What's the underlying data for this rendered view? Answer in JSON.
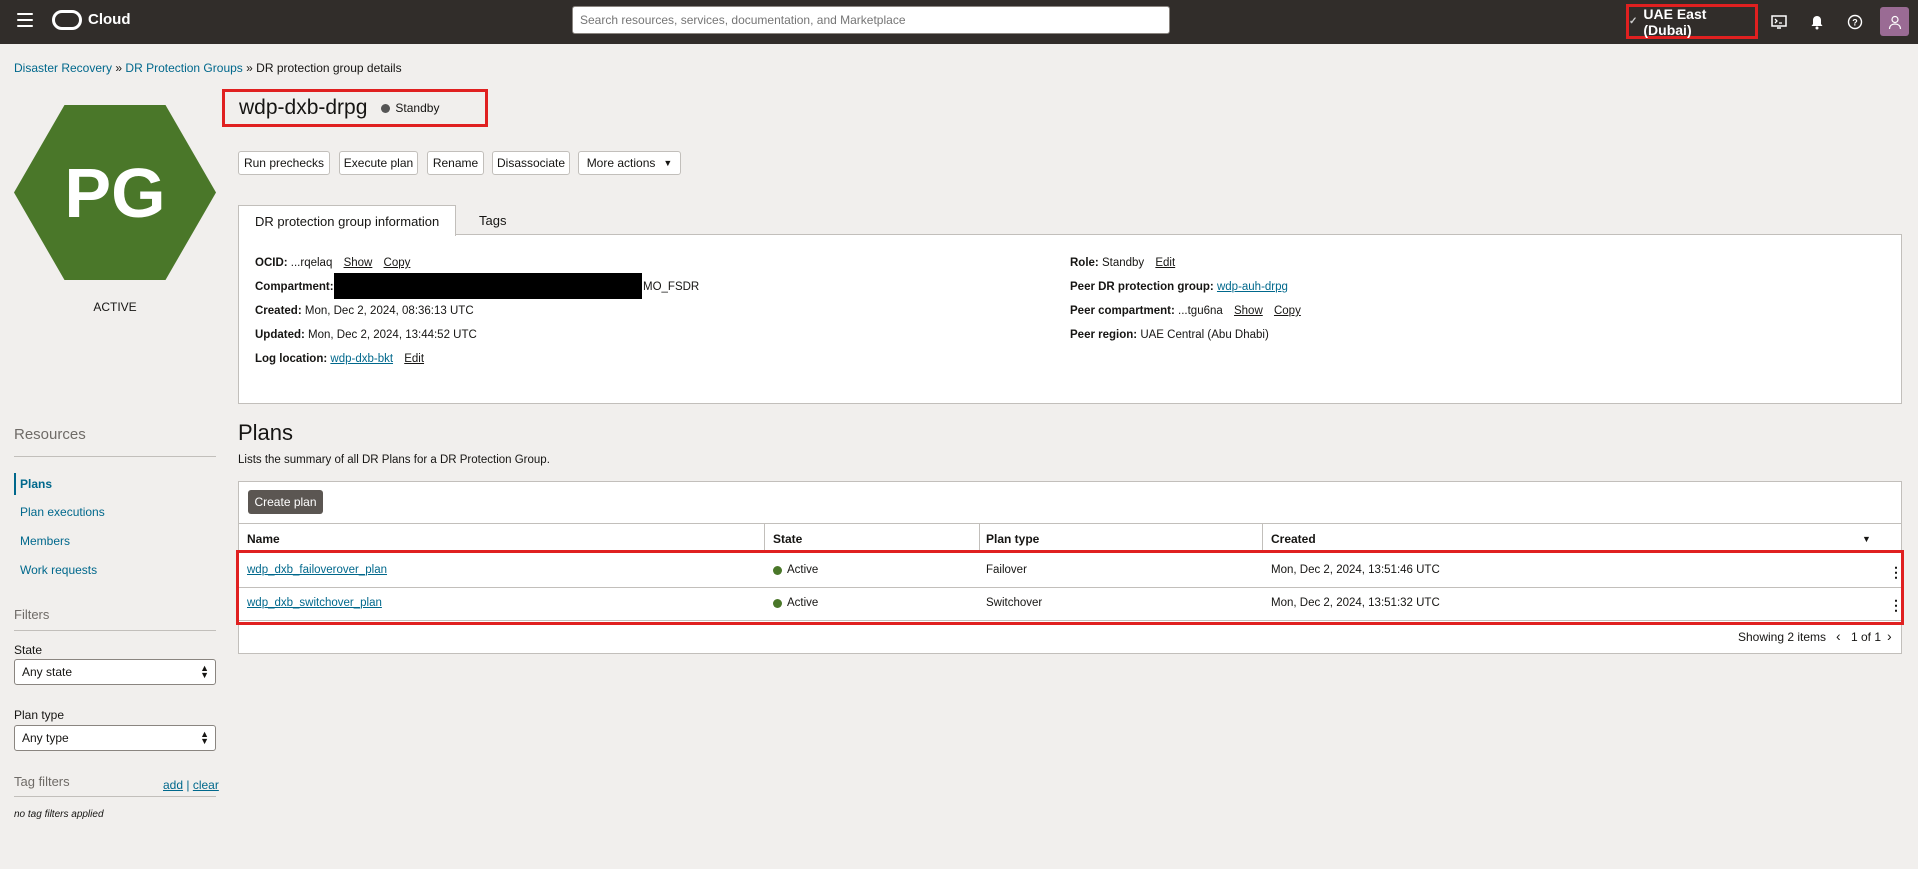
{
  "topbar": {
    "brand": "Cloud",
    "search_placeholder": "Search resources, services, documentation, and Marketplace",
    "region": "UAE East (Dubai)",
    "icons": [
      "menu-icon",
      "oracle-logo",
      "cloud-shell-icon",
      "bell-icon",
      "help-icon",
      "user-icon"
    ]
  },
  "breadcrumb": {
    "items": [
      "Disaster Recovery",
      "DR Protection Groups",
      "DR protection group details"
    ],
    "sep": "»"
  },
  "resource": {
    "badge": "PG",
    "badge_color": "#4a7729",
    "lifecycle": "ACTIVE",
    "name": "wdp-dxb-drpg",
    "role_badge": "Standby",
    "role_badge_color": "#555555"
  },
  "actions": {
    "run_prechecks": "Run prechecks",
    "execute_plan": "Execute plan",
    "rename": "Rename",
    "disassociate": "Disassociate",
    "more_actions": "More actions"
  },
  "tabs": {
    "info": "DR protection group information",
    "tags": "Tags"
  },
  "info": {
    "ocid_label": "OCID:",
    "ocid_value": "...rqelaq",
    "show": "Show",
    "copy": "Copy",
    "compartment_label": "Compartment:",
    "compartment_suffix": "MO_FSDR",
    "created_label": "Created:",
    "created_value": "Mon, Dec 2, 2024, 08:36:13 UTC",
    "updated_label": "Updated:",
    "updated_value": "Mon, Dec 2, 2024, 13:44:52 UTC",
    "log_label": "Log location:",
    "log_value": "wdp-dxb-bkt",
    "edit": "Edit",
    "role_label": "Role:",
    "role_value": "Standby",
    "peer_group_label": "Peer DR protection group:",
    "peer_group_value": "wdp-auh-drpg",
    "peer_comp_label": "Peer compartment:",
    "peer_comp_value": "...tgu6na",
    "peer_region_label": "Peer region:",
    "peer_region_value": "UAE Central (Abu Dhabi)"
  },
  "sidebar": {
    "resources_title": "Resources",
    "items": [
      "Plans",
      "Plan executions",
      "Members",
      "Work requests"
    ],
    "filters_title": "Filters",
    "state_label": "State",
    "state_value": "Any state",
    "plantype_label": "Plan type",
    "plantype_value": "Any type",
    "tagfilters_title": "Tag filters",
    "add": "add",
    "bar": "|",
    "clear": "clear",
    "no_tags": "no tag filters applied"
  },
  "plans": {
    "title": "Plans",
    "description": "Lists the summary of all DR Plans for a DR Protection Group.",
    "create_button": "Create plan",
    "columns": [
      "Name",
      "State",
      "Plan type",
      "Created"
    ],
    "rows": [
      {
        "name": "wdp_dxb_failoverover_plan",
        "state": "Active",
        "type": "Failover",
        "created": "Mon, Dec 2, 2024, 13:51:46 UTC"
      },
      {
        "name": "wdp_dxb_switchover_plan",
        "state": "Active",
        "type": "Switchover",
        "created": "Mon, Dec 2, 2024, 13:51:32 UTC"
      }
    ],
    "state_color": "#4a7729",
    "showing": "Showing 2 items",
    "page": "1 of 1"
  }
}
